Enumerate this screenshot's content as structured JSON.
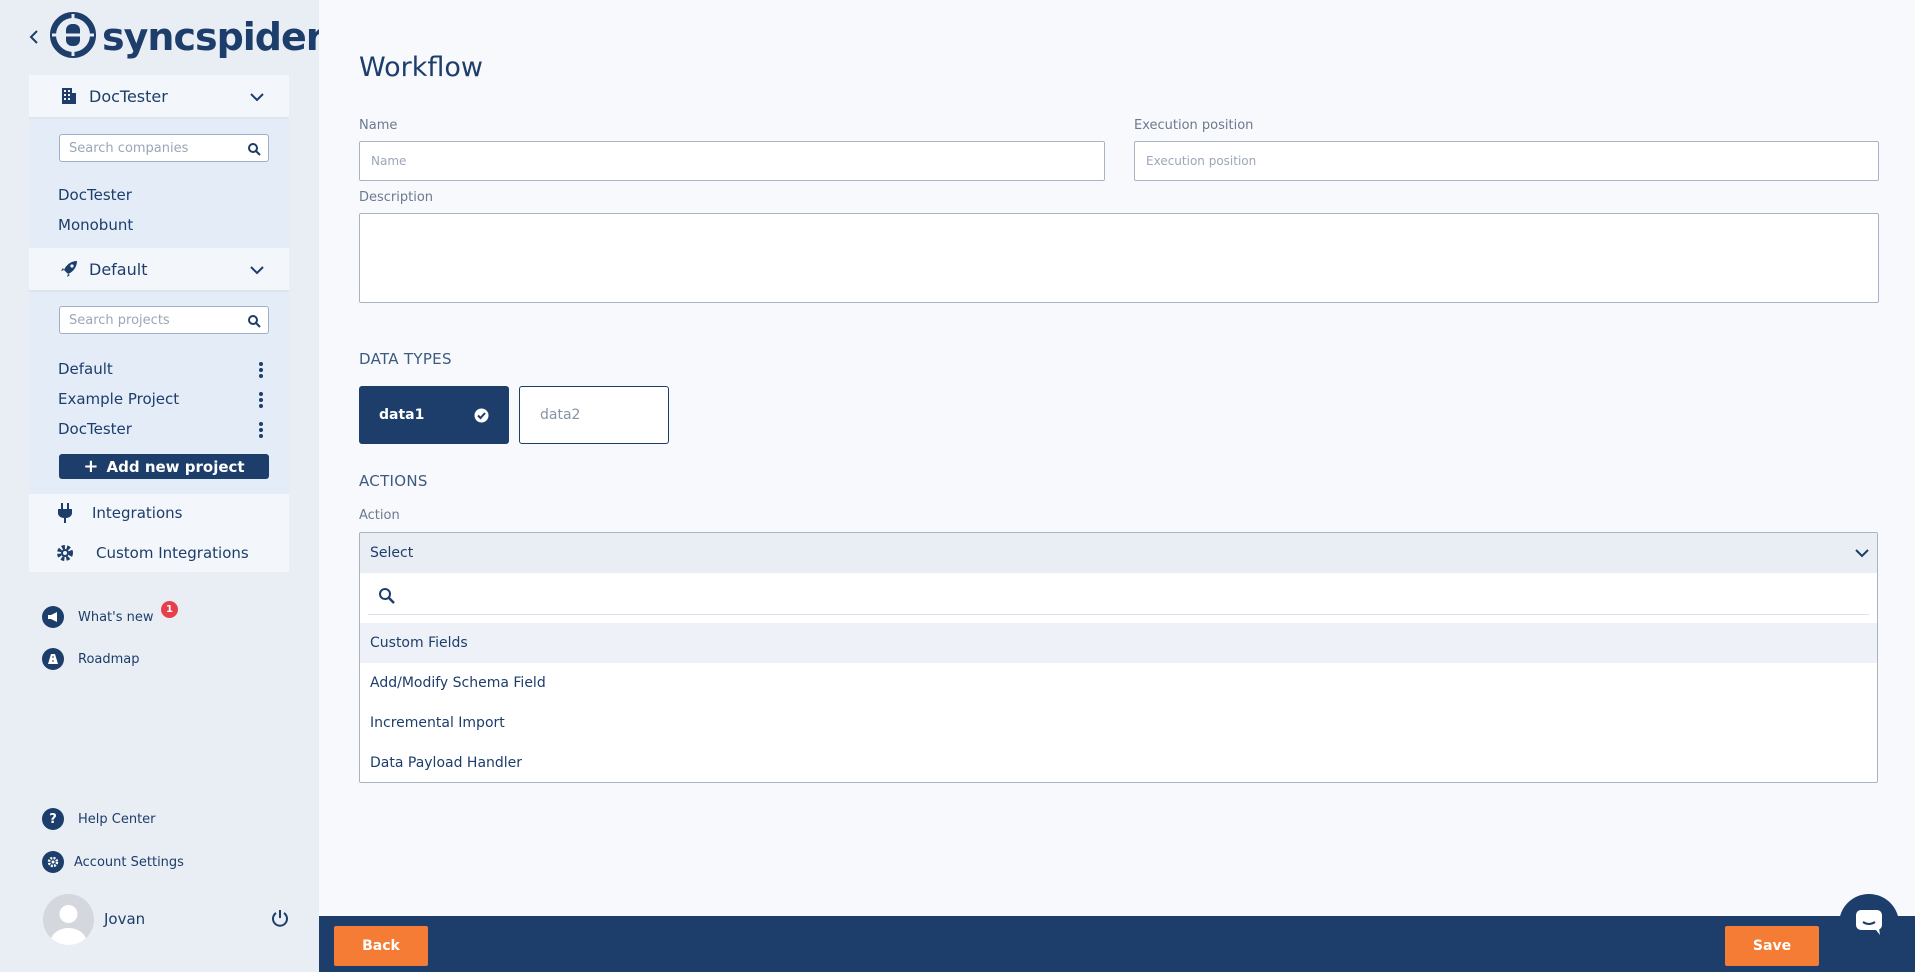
{
  "brand": {
    "logo_text": "syncspider"
  },
  "company": {
    "selected": "DocTester",
    "search_placeholder": "Search companies",
    "items": [
      "DocTester",
      "Monobunt"
    ]
  },
  "project": {
    "selected": "Default",
    "search_placeholder": "Search projects",
    "items": [
      "Default",
      "Example Project",
      "DocTester"
    ],
    "add_label": "Add new project"
  },
  "nav": {
    "integrations": "Integrations",
    "custom_integrations": "Custom Integrations"
  },
  "footer_nav": {
    "whats_new": "What's new",
    "whats_new_badge": "1",
    "roadmap": "Roadmap",
    "help_center": "Help Center",
    "account_settings": "Account Settings"
  },
  "user": {
    "name": "Jovan"
  },
  "workflow": {
    "title": "Workflow",
    "name_label": "Name",
    "name_placeholder": "Name",
    "exec_label": "Execution position",
    "exec_placeholder": "Execution position",
    "desc_label": "Description"
  },
  "data_types": {
    "title": "DATA TYPES",
    "items": [
      {
        "label": "data1",
        "selected": true
      },
      {
        "label": "data2",
        "selected": false
      }
    ]
  },
  "actions": {
    "title": "ACTIONS",
    "action_label": "Action",
    "select_value": "Select",
    "search_value": "",
    "options": [
      "Custom Fields",
      "Add/Modify Schema Field",
      "Incremental Import",
      "Data Payload Handler"
    ]
  },
  "buttons": {
    "back": "Back",
    "save": "Save"
  },
  "colors": {
    "primary": "#1d3d6b",
    "accent": "#f57c35",
    "badge": "#e8404a"
  }
}
